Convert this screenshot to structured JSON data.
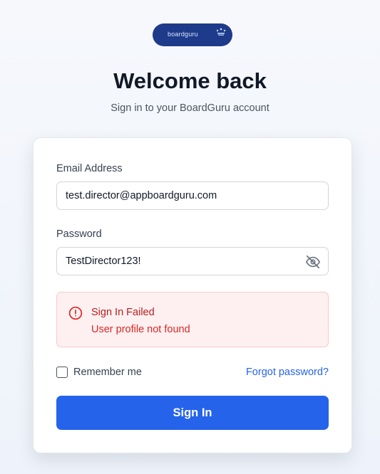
{
  "brand": {
    "logo_text": "boardguru",
    "color": "#1e3a8a"
  },
  "header": {
    "title": "Welcome back",
    "subtitle": "Sign in to your BoardGuru account"
  },
  "form": {
    "email": {
      "label": "Email Address",
      "value": "test.director@appboardguru.com"
    },
    "password": {
      "label": "Password",
      "value": "TestDirector123!",
      "toggle_icon": "eye-off-icon"
    },
    "alert": {
      "icon": "alert-circle-icon",
      "title": "Sign In Failed",
      "message": "User profile not found",
      "color": "#dc2626"
    },
    "remember_label": "Remember me",
    "forgot_label": "Forgot password?",
    "submit_label": "Sign In",
    "accent": "#2563eb"
  }
}
